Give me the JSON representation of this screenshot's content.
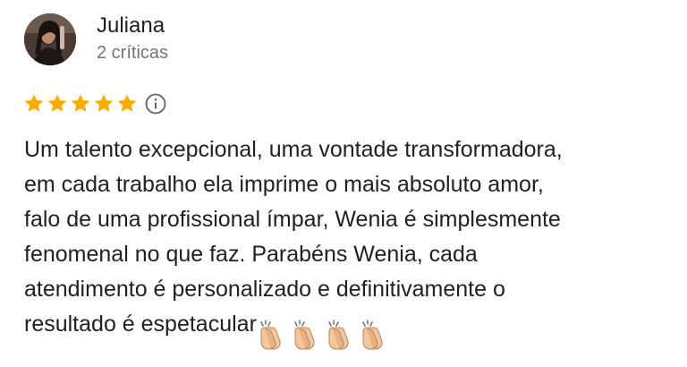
{
  "reviewer": {
    "name": "Juliana",
    "review_count": "2 críticas"
  },
  "rating": {
    "stars": 5,
    "max": 5,
    "star_color": "#f9ab00",
    "info_icon": "info-icon"
  },
  "review": {
    "text": "Um talento excepcional, uma vontade transformadora,\nem cada trabalho ela imprime o mais absoluto amor,\nfalo de uma profissional ímpar, Wenia é simplesmente\nfenomenal no que faz. Parabéns Wenia, cada\natendimento é personalizado e definitivamente o\nresultado é espetacular",
    "emoji": [
      "clapping-hands-icon",
      "clapping-hands-icon",
      "clapping-hands-icon",
      "clapping-hands-icon"
    ]
  }
}
